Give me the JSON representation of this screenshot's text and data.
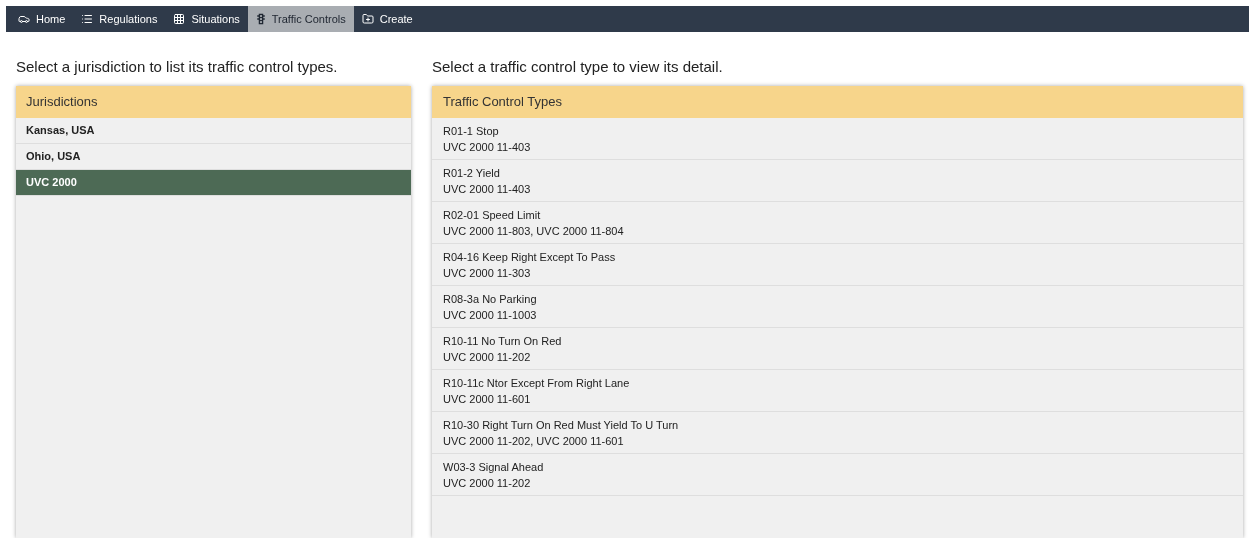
{
  "nav": [
    {
      "label": "Home",
      "selected": false
    },
    {
      "label": "Regulations",
      "selected": false
    },
    {
      "label": "Situations",
      "selected": false
    },
    {
      "label": "Traffic Controls",
      "selected": true
    },
    {
      "label": "Create",
      "selected": false
    }
  ],
  "jurisdictions": {
    "prompt": "Select a jurisdiction to list its traffic control types.",
    "title": "Jurisdictions",
    "items": [
      {
        "label": "Kansas, USA",
        "selected": false
      },
      {
        "label": "Ohio, USA",
        "selected": false
      },
      {
        "label": "UVC 2000",
        "selected": true
      }
    ]
  },
  "traffic_control_types": {
    "prompt": "Select a traffic control type to view its detail.",
    "title": "Traffic Control Types",
    "items": [
      {
        "name": "R01-1 Stop",
        "references": "UVC 2000 11-403"
      },
      {
        "name": "R01-2 Yield",
        "references": "UVC 2000 11-403"
      },
      {
        "name": "R02-01 Speed Limit",
        "references": "UVC 2000 11-803, UVC 2000 11-804"
      },
      {
        "name": "R04-16 Keep Right Except To Pass",
        "references": "UVC 2000 11-303"
      },
      {
        "name": "R08-3a No Parking",
        "references": "UVC 2000 11-1003"
      },
      {
        "name": "R10-11 No Turn On Red",
        "references": "UVC 2000 11-202"
      },
      {
        "name": "R10-11c Ntor Except From Right Lane",
        "references": "UVC 2000 11-601"
      },
      {
        "name": "R10-30 Right Turn On Red Must Yield To U Turn",
        "references": "UVC 2000 11-202, UVC 2000 11-601"
      },
      {
        "name": "W03-3 Signal Ahead",
        "references": "UVC 2000 11-202"
      }
    ]
  }
}
